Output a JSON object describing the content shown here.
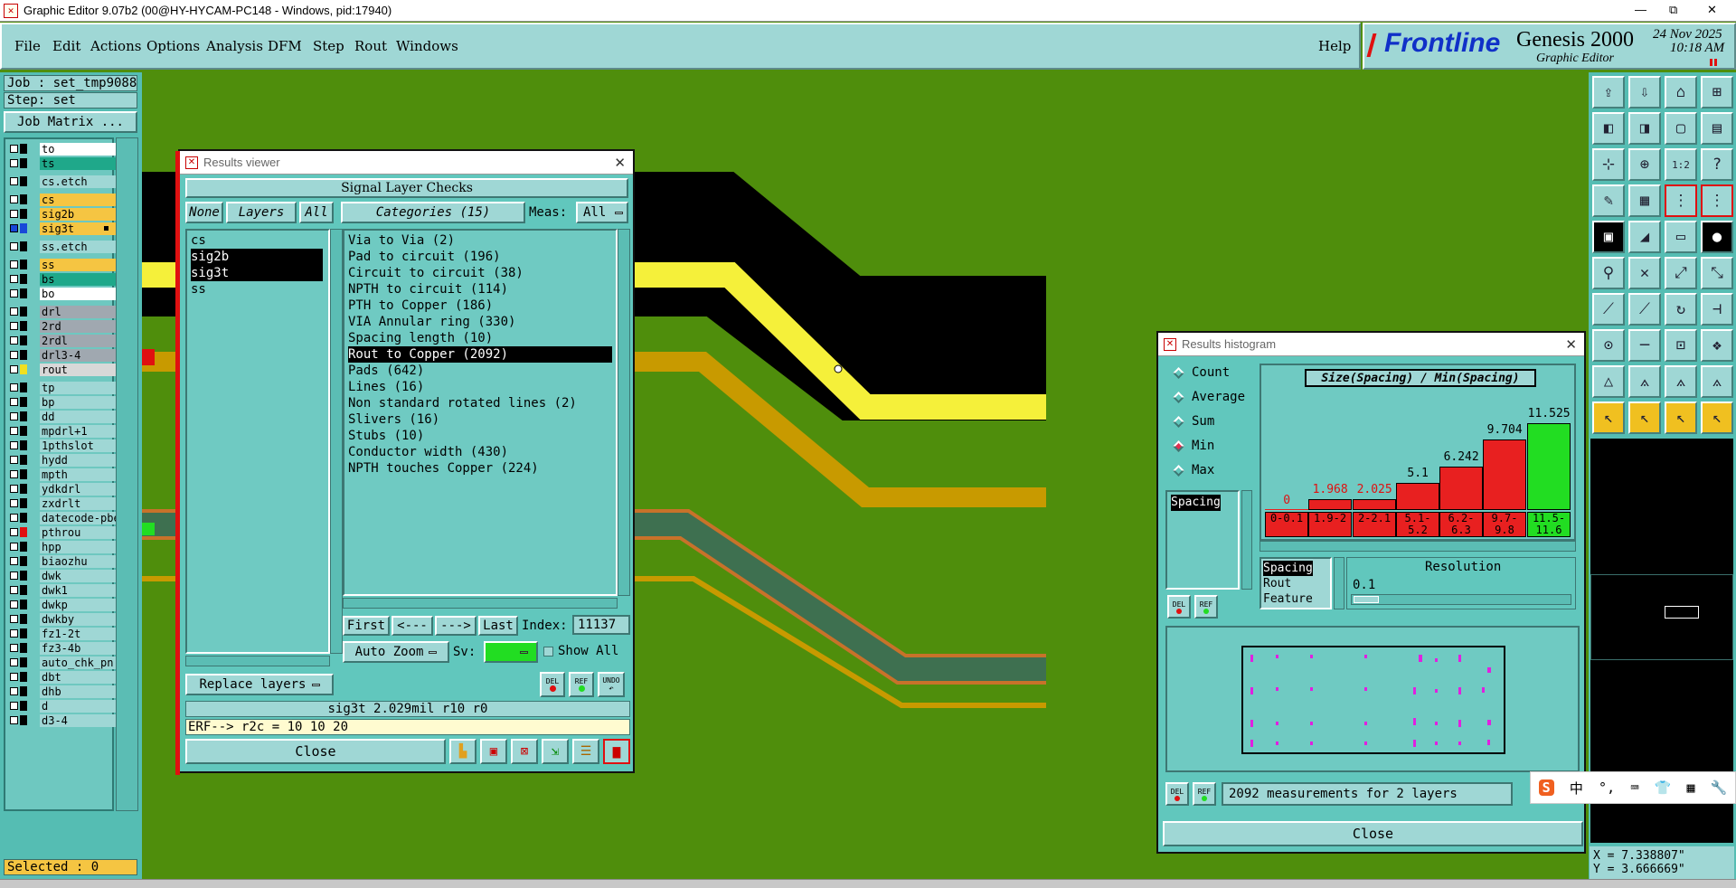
{
  "window": {
    "title": "Graphic Editor 9.07b2 (00@HY-HYCAM-PC148 - Windows, pid:17940)",
    "controls": [
      "—",
      "⧉",
      "✕"
    ]
  },
  "menu": {
    "items": [
      "File",
      "Edit",
      "Actions",
      "Options",
      "Analysis",
      "DFM",
      "Step",
      "Rout",
      "Windows"
    ],
    "help": "Help"
  },
  "brand": {
    "logo": "Frontline",
    "product": "Genesis 2000",
    "subtitle": "Graphic Editor",
    "date": "24 Nov 2025",
    "time": "10:18 AM"
  },
  "left": {
    "job": "Job : set_tmp9088",
    "step": "Step: set",
    "job_matrix": "Job Matrix ...",
    "selected": "Selected : 0",
    "layers": [
      {
        "name": "to",
        "bg": "#ffffff",
        "color": "#000000",
        "section": 1
      },
      {
        "name": "ts",
        "bg": "#1fa88a",
        "color": "#000000",
        "section": 1
      },
      {
        "name": "cs.etch",
        "bg": "#9fd7d5",
        "color": "#000000",
        "section": 2
      },
      {
        "name": "cs",
        "bg": "#f5c542",
        "color": "#000000",
        "section": 3
      },
      {
        "name": "sig2b",
        "bg": "#f5c542",
        "color": "#000000",
        "section": 3
      },
      {
        "name": "sig3t",
        "bg": "#f5c542",
        "color": "#1848d8",
        "section": 3,
        "marked": true
      },
      {
        "name": "ss.etch",
        "bg": "#9fd7d5",
        "color": "#000000",
        "section": 4
      },
      {
        "name": "ss",
        "bg": "#f5c542",
        "color": "#000000",
        "section": 5
      },
      {
        "name": "bs",
        "bg": "#1fa88a",
        "color": "#000000",
        "section": 5
      },
      {
        "name": "bo",
        "bg": "#ffffff",
        "color": "#000000",
        "section": 5
      },
      {
        "name": "drl",
        "bg": "#a0a8b0",
        "color": "#000000",
        "section": 6
      },
      {
        "name": "2rd",
        "bg": "#a0a8b0",
        "color": "#000000",
        "section": 6
      },
      {
        "name": "2rdl",
        "bg": "#a0a8b0",
        "color": "#000000",
        "section": 6
      },
      {
        "name": "drl3-4",
        "bg": "#a0a8b0",
        "color": "#000000",
        "section": 6
      },
      {
        "name": "rout",
        "bg": "#d8d8d8",
        "color": "#f0e020",
        "section": 6
      },
      {
        "name": "tp",
        "bg": "#9fd7d5",
        "color": "#000000",
        "section": 7
      },
      {
        "name": "bp",
        "bg": "#9fd7d5",
        "color": "#000000",
        "section": 7
      },
      {
        "name": "dd",
        "bg": "#9fd7d5",
        "color": "#000000",
        "section": 7
      },
      {
        "name": "mpdrl+1",
        "bg": "#9fd7d5",
        "color": "#000000",
        "section": 7
      },
      {
        "name": "1pthslot",
        "bg": "#9fd7d5",
        "color": "#000000",
        "section": 7
      },
      {
        "name": "hydd",
        "bg": "#9fd7d5",
        "color": "#000000",
        "section": 7
      },
      {
        "name": "mpth",
        "bg": "#9fd7d5",
        "color": "#000000",
        "section": 7
      },
      {
        "name": "ydkdrl",
        "bg": "#9fd7d5",
        "color": "#000000",
        "section": 7
      },
      {
        "name": "zxdrlt",
        "bg": "#9fd7d5",
        "color": "#000000",
        "section": 7
      },
      {
        "name": "datecode-pbe",
        "bg": "#9fd7d5",
        "color": "#000000",
        "section": 7
      },
      {
        "name": "pthrou",
        "bg": "#9fd7d5",
        "color": "#e01010",
        "section": 7
      },
      {
        "name": "hpp",
        "bg": "#9fd7d5",
        "color": "#000000",
        "section": 7
      },
      {
        "name": "biaozhu",
        "bg": "#9fd7d5",
        "color": "#000000",
        "section": 7
      },
      {
        "name": "dwk",
        "bg": "#9fd7d5",
        "color": "#000000",
        "section": 7
      },
      {
        "name": "dwk1",
        "bg": "#9fd7d5",
        "color": "#000000",
        "section": 7
      },
      {
        "name": "dwkp",
        "bg": "#9fd7d5",
        "color": "#000000",
        "section": 7
      },
      {
        "name": "dwkby",
        "bg": "#9fd7d5",
        "color": "#000000",
        "section": 7
      },
      {
        "name": "fz1-2t",
        "bg": "#9fd7d5",
        "color": "#000000",
        "section": 7
      },
      {
        "name": "fz3-4b",
        "bg": "#9fd7d5",
        "color": "#000000",
        "section": 7
      },
      {
        "name": "auto_chk_pn",
        "bg": "#9fd7d5",
        "color": "#000000",
        "section": 7
      },
      {
        "name": "dbt",
        "bg": "#9fd7d5",
        "color": "#000000",
        "section": 7
      },
      {
        "name": "dhb",
        "bg": "#9fd7d5",
        "color": "#000000",
        "section": 7
      },
      {
        "name": "d",
        "bg": "#9fd7d5",
        "color": "#000000",
        "section": 7
      },
      {
        "name": "d3-4",
        "bg": "#9fd7d5",
        "color": "#000000",
        "section": 7
      }
    ]
  },
  "results_viewer": {
    "title": "Results viewer",
    "header": "Signal Layer Checks",
    "none_btn": "None",
    "layers_btn": "Layers",
    "all_btn": "All",
    "categories_btn": "Categories (15)",
    "meas_label": "Meas:",
    "meas_value": "All",
    "layers": [
      "cs",
      "sig2b",
      "sig3t",
      "ss"
    ],
    "selected_layers": [
      "sig2b",
      "sig3t"
    ],
    "categories": [
      "Via to Via (2)",
      "Pad to circuit (196)",
      "Circuit to circuit (38)",
      "NPTH to circuit (114)",
      "PTH to Copper (186)",
      "VIA Annular ring (330)",
      "Spacing length (10)",
      "Rout to Copper (2092)",
      "Pads (642)",
      "Lines (16)",
      "Non standard rotated lines (2)",
      "Slivers (16)",
      "Stubs (10)",
      "Conductor width (430)",
      "NPTH touches Copper (224)"
    ],
    "selected_category": "Rout to Copper (2092)",
    "first": "First",
    "prev": "<---",
    "next": "--->",
    "last": "Last",
    "index_label": "Index:",
    "index_value": "11137",
    "auto_zoom": "Auto Zoom",
    "sv_label": "Sv:",
    "show_all": "Show All",
    "replace_layers": "Replace layers",
    "del": "DEL",
    "ref": "REF",
    "undo": "UNDO",
    "status": "sig3t 2.029mil   r10   r0",
    "erf": "ERF--> r2c = 10 10 20",
    "close": "Close"
  },
  "histogram": {
    "title": "Results histogram",
    "modes": [
      "Count",
      "Average",
      "Sum",
      "Min",
      "Max"
    ],
    "selected_mode": "Min",
    "chart_title": "Size(Spacing) / Min(Spacing)",
    "list_item": "Spacing",
    "bins": [
      {
        "label": "0-0.1",
        "value": "0",
        "fraction": 0.0,
        "color": "#e82020"
      },
      {
        "label": "1.9-2",
        "value": "1.968",
        "fraction": 0.12,
        "color": "#e82020"
      },
      {
        "label": "2-2.1",
        "value": "2.025",
        "fraction": 0.12,
        "color": "#e82020"
      },
      {
        "label": "5.1-5.2",
        "value": "5.1",
        "fraction": 0.3,
        "color": "#e82020"
      },
      {
        "label": "6.2-6.3",
        "value": "6.242",
        "fraction": 0.48,
        "color": "#e82020"
      },
      {
        "label": "9.7-9.8",
        "value": "9.704",
        "fraction": 0.78,
        "color": "#e82020"
      },
      {
        "label": "11.5-11.6",
        "value": "11.525",
        "fraction": 0.96,
        "color": "#22dd22"
      }
    ],
    "value_colors": [
      "#e01010",
      "#e01010",
      "#e01010",
      "#000000",
      "#000000",
      "#000000",
      "#000000"
    ],
    "group_options": [
      "Spacing",
      "Rout",
      "Feature"
    ],
    "resolution_label": "Resolution",
    "resolution_value": "0.1",
    "measurements": "2092 measurements for 2 layers",
    "del": "DEL",
    "ref": "REF",
    "close": "Close"
  },
  "coords": {
    "x": "X = 7.338807\"",
    "y": "Y = 3.666669\""
  },
  "ime": [
    "S",
    "中",
    "°,",
    "⌨",
    "👕",
    "▦",
    "🔧"
  ],
  "colors": {
    "board_green": "#4f8e0c",
    "panel_teal": "#55bdb3",
    "trace_yellow": "#f5f03a",
    "trace_orange": "#c89a00",
    "trace_black": "#000000"
  }
}
